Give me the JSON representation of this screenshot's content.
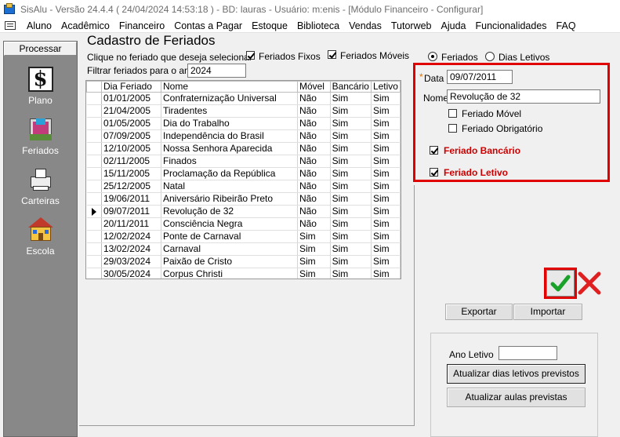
{
  "window": {
    "title": "SisAlu - Versão 24.4.4 ( 24/04/2024 14:53:18 ) - BD: lauras - Usuário: m:enis - [Módulo Financeiro - Configurar]"
  },
  "menu": [
    "Aluno",
    "Acadêmico",
    "Financeiro",
    "Contas a Pagar",
    "Estoque",
    "Biblioteca",
    "Vendas",
    "Tutorweb",
    "Ajuda",
    "Funcionalidades",
    "FAQ"
  ],
  "sidebar": {
    "header": "Processar",
    "items": [
      {
        "label": "Plano",
        "icon": "dollar-icon"
      },
      {
        "label": "Feriados",
        "icon": "calendar-icon"
      },
      {
        "label": "Carteiras",
        "icon": "printer-icon"
      },
      {
        "label": "Escola",
        "icon": "school-icon"
      }
    ]
  },
  "page": {
    "title": "Cadastro de Feriados",
    "hint": "Clique no feriado que deseja selecionar",
    "filter_label": "Filtrar feriados para o ano",
    "filter_year": "2024",
    "chk_fixos": {
      "label": "Feriados Fixos",
      "checked": true
    },
    "chk_moveis": {
      "label": "Feriados Móveis",
      "checked": true
    },
    "radio_feriados": {
      "label": "Feriados",
      "selected": true
    },
    "radio_letivos": {
      "label": "Dias Letivos",
      "selected": false
    }
  },
  "grid": {
    "columns": [
      "Dia Feriado",
      "Nome",
      "Móvel",
      "Bancário",
      "Letivo"
    ],
    "current_row": 9,
    "rows": [
      [
        "01/01/2005",
        "Confraternização Universal",
        "Não",
        "Sim",
        "Sim"
      ],
      [
        "21/04/2005",
        "Tiradentes",
        "Não",
        "Sim",
        "Sim"
      ],
      [
        "01/05/2005",
        "Dia do Trabalho",
        "Não",
        "Sim",
        "Sim"
      ],
      [
        "07/09/2005",
        "Independência do Brasil",
        "Não",
        "Sim",
        "Sim"
      ],
      [
        "12/10/2005",
        "Nossa Senhora Aparecida",
        "Não",
        "Sim",
        "Sim"
      ],
      [
        "02/11/2005",
        "Finados",
        "Não",
        "Sim",
        "Sim"
      ],
      [
        "15/11/2005",
        "Proclamação da República",
        "Não",
        "Sim",
        "Sim"
      ],
      [
        "25/12/2005",
        "Natal",
        "Não",
        "Sim",
        "Sim"
      ],
      [
        "19/06/2011",
        "Aniversário Ribeirão Preto",
        "Não",
        "Sim",
        "Sim"
      ],
      [
        "09/07/2011",
        "Revolução de 32",
        "Não",
        "Sim",
        "Sim"
      ],
      [
        "20/11/2011",
        "Consciência Negra",
        "Não",
        "Sim",
        "Sim"
      ],
      [
        "12/02/2024",
        "Ponte de Carnaval",
        "Sim",
        "Sim",
        "Sim"
      ],
      [
        "13/02/2024",
        "Carnaval",
        "Sim",
        "Sim",
        "Sim"
      ],
      [
        "29/03/2024",
        "Paixão de Cristo",
        "Sim",
        "Sim",
        "Sim"
      ],
      [
        "30/05/2024",
        "Corpus Christi",
        "Sim",
        "Sim",
        "Sim"
      ]
    ]
  },
  "form": {
    "required_mark": "*",
    "data_label": "Data",
    "data_value": "09/07/2011",
    "nome_label": "Nome",
    "nome_value": "Revolução de 32",
    "movel": {
      "label": "Feriado Móvel",
      "checked": false
    },
    "obrigatorio": {
      "label": "Feriado Obrigatório",
      "checked": false
    },
    "bancario": {
      "label": "Feriado Bancário",
      "checked": true
    },
    "letivo": {
      "label": "Feriado Letivo",
      "checked": true
    },
    "highlight_color": "#e00000"
  },
  "actions": {
    "confirm_icon": "check-icon",
    "cancel_icon": "cancel-icon",
    "exportar": "Exportar",
    "importar": "Importar"
  },
  "ano_letivo": {
    "label": "Ano Letivo",
    "value": "",
    "btn_dias": "Atualizar dias letivos previstos",
    "btn_aulas": "Atualizar aulas previstas"
  }
}
